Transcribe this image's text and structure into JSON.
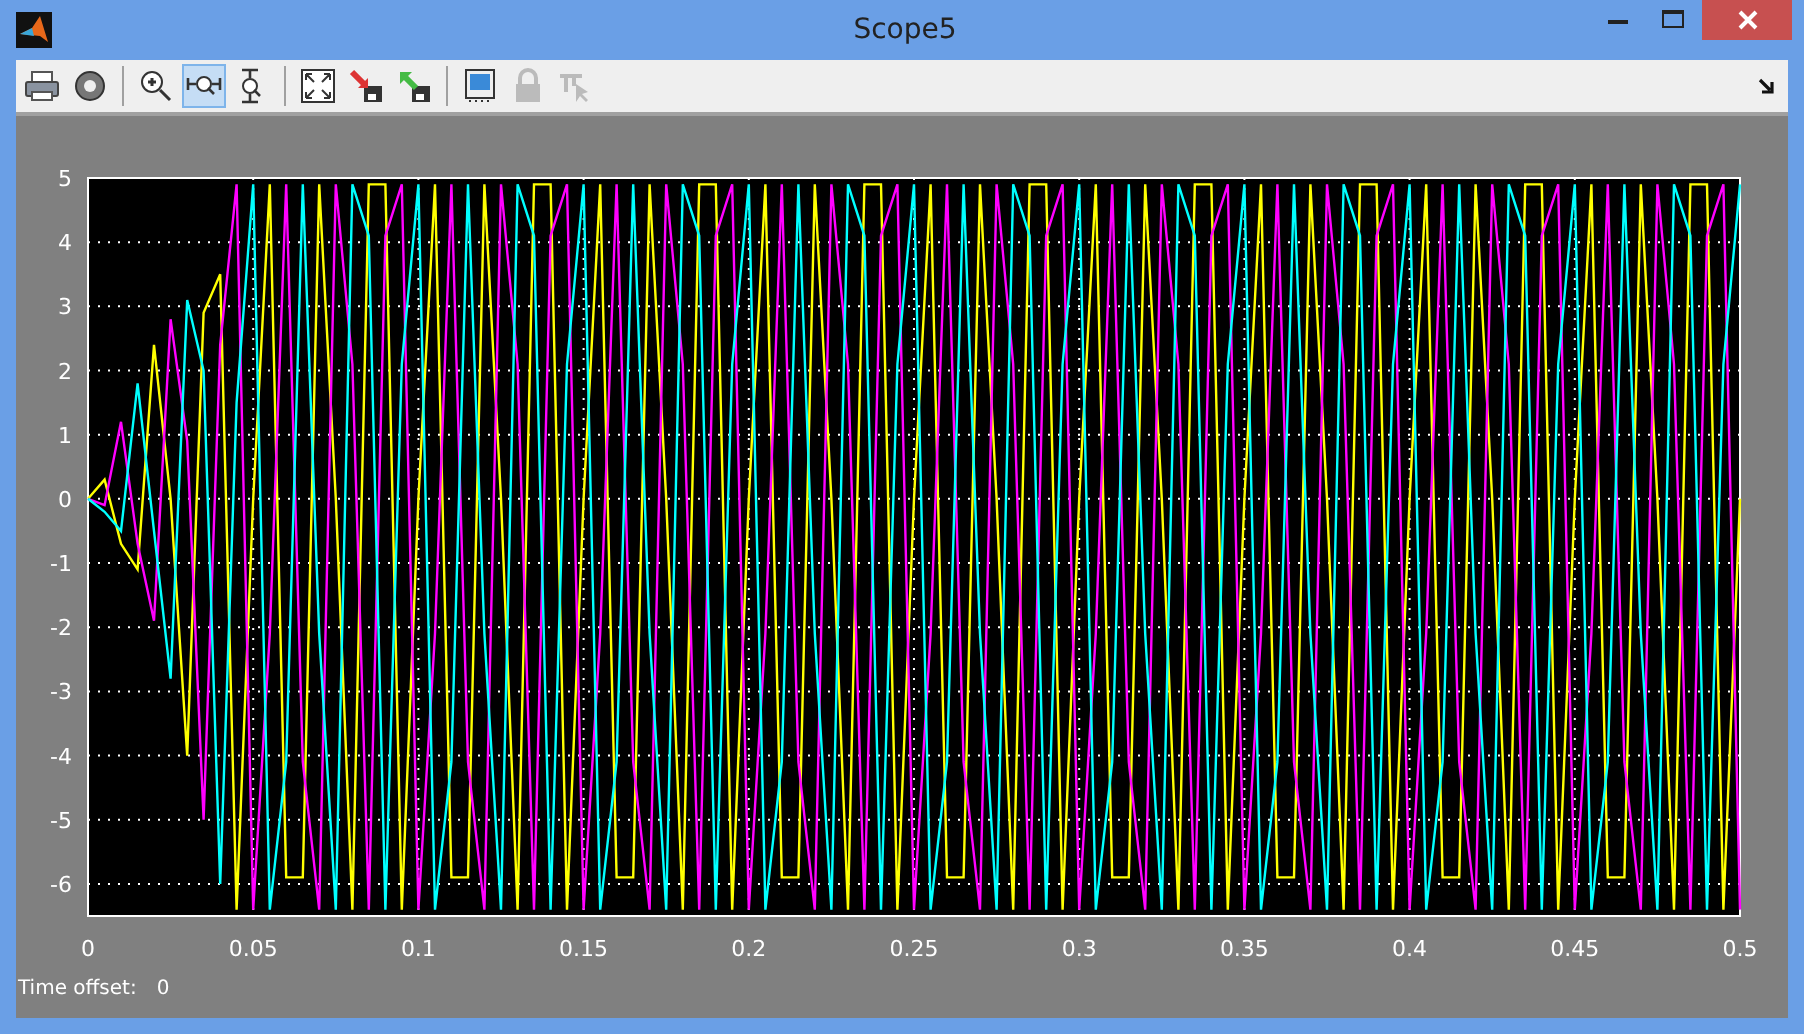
{
  "window": {
    "title": "Scope5"
  },
  "toolbar": [
    {
      "kind": "print",
      "selected": false,
      "disabled": false
    },
    {
      "kind": "parameters",
      "selected": false,
      "disabled": false
    },
    {
      "kind": "zoom",
      "selected": false,
      "disabled": false
    },
    {
      "kind": "zoomx",
      "selected": true,
      "disabled": false
    },
    {
      "kind": "zoomy",
      "selected": false,
      "disabled": false
    },
    {
      "kind": "autoscale",
      "selected": false,
      "disabled": false
    },
    {
      "kind": "saveaxes",
      "selected": false,
      "disabled": false
    },
    {
      "kind": "restoreaxes",
      "selected": false,
      "disabled": false
    },
    {
      "kind": "floating",
      "selected": false,
      "disabled": false
    },
    {
      "kind": "lock",
      "selected": false,
      "disabled": true
    },
    {
      "kind": "signals",
      "selected": false,
      "disabled": true
    }
  ],
  "chart_data": {
    "type": "line",
    "grid": true,
    "xlim": [
      0,
      0.5
    ],
    "ylim": [
      -6.5,
      5
    ],
    "xticks": [
      0,
      {
        "value": 0.05,
        "label": "0.05"
      },
      {
        "value": 0.1,
        "label": "0.1"
      },
      {
        "value": 0.15,
        "label": "0.15"
      },
      {
        "value": 0.2,
        "label": "0.2"
      },
      {
        "value": 0.25,
        "label": "0.25"
      },
      {
        "value": 0.3,
        "label": "0.3"
      },
      {
        "value": 0.35,
        "label": "0.35"
      },
      {
        "value": 0.4,
        "label": "0.4"
      },
      {
        "value": 0.45,
        "label": "0.45"
      },
      {
        "value": 0.5,
        "label": "0.5"
      }
    ],
    "yticks": [
      -6,
      -5,
      -4,
      -3,
      -2,
      -1,
      0,
      1,
      2,
      3,
      4,
      5
    ],
    "x": [
      0,
      0.005,
      0.01,
      0.015,
      0.02,
      0.025,
      0.03,
      0.035,
      0.04,
      0.045,
      0.05,
      0.055,
      0.06,
      0.065,
      0.07,
      0.075,
      0.08,
      0.085,
      0.09,
      0.095,
      0.1,
      0.105,
      0.11,
      0.115,
      0.12,
      0.125,
      0.13,
      0.135,
      0.14,
      0.145,
      0.15,
      0.155,
      0.16,
      0.165,
      0.17,
      0.175,
      0.18,
      0.185,
      0.19,
      0.195,
      0.2,
      0.205,
      0.21,
      0.215,
      0.22,
      0.225,
      0.23,
      0.235,
      0.24,
      0.245,
      0.25,
      0.255,
      0.26,
      0.265,
      0.27,
      0.275,
      0.28,
      0.285,
      0.29,
      0.295,
      0.3,
      0.305,
      0.31,
      0.315,
      0.32,
      0.325,
      0.33,
      0.335,
      0.34,
      0.345,
      0.35,
      0.355,
      0.36,
      0.365,
      0.37,
      0.375,
      0.38,
      0.385,
      0.39,
      0.395,
      0.4,
      0.405,
      0.41,
      0.415,
      0.42,
      0.425,
      0.43,
      0.435,
      0.44,
      0.445,
      0.45,
      0.455,
      0.46,
      0.465,
      0.47,
      0.475,
      0.48,
      0.485,
      0.49,
      0.495,
      0.5
    ],
    "series": [
      {
        "color": "#ffff00",
        "values": [
          0,
          0.3,
          -0.7,
          -1.1,
          2.4,
          0,
          -4,
          2.9,
          3.5,
          -6.4,
          0,
          4.9,
          -5.9,
          -5.9,
          4.9,
          0,
          -6.4,
          4.9,
          4.9,
          -6.4,
          0,
          4.9,
          -5.9,
          -5.9,
          4.9,
          0,
          -6.4,
          4.9,
          4.9,
          -6.4,
          0,
          4.9,
          -5.9,
          -5.9,
          4.9,
          0,
          -6.4,
          4.9,
          4.9,
          -6.4,
          0,
          4.9,
          -5.9,
          -5.9,
          4.9,
          0,
          -6.4,
          4.9,
          4.9,
          -6.4,
          0,
          4.9,
          -5.9,
          -5.9,
          4.9,
          0,
          -6.4,
          4.9,
          4.9,
          -6.4,
          0,
          4.9,
          -5.9,
          -5.9,
          4.9,
          0,
          -6.4,
          4.9,
          4.9,
          -6.4,
          0,
          4.9,
          -5.9,
          -5.9,
          4.9,
          0,
          -6.4,
          4.9,
          4.9,
          -6.4,
          0,
          4.9,
          -5.9,
          -5.9,
          4.9,
          0,
          -6.4,
          4.9,
          4.9,
          -6.4,
          0,
          4.9,
          -5.9,
          -5.9,
          4.9,
          0,
          -6.4,
          4.9,
          4.9,
          -6.4,
          0
        ]
      },
      {
        "color": "#ff00ff",
        "values": [
          0,
          -0.1,
          1.2,
          -0.7,
          -1.9,
          2.8,
          0.9,
          -5,
          2.4,
          4.9,
          -6.4,
          -2.1,
          4.9,
          -4.1,
          -6.4,
          4.9,
          2.1,
          -6.4,
          4.1,
          4.9,
          -6.4,
          -2.1,
          4.9,
          -4.1,
          -6.4,
          4.9,
          2.1,
          -6.4,
          4.1,
          4.9,
          -6.4,
          -2.1,
          4.9,
          -4.1,
          -6.4,
          4.9,
          2.1,
          -6.4,
          4.1,
          4.9,
          -6.4,
          -2.1,
          4.9,
          -4.1,
          -6.4,
          4.9,
          2.1,
          -6.4,
          4.1,
          4.9,
          -6.4,
          -2.1,
          4.9,
          -4.1,
          -6.4,
          4.9,
          2.1,
          -6.4,
          4.1,
          4.9,
          -6.4,
          -2.1,
          4.9,
          -4.1,
          -6.4,
          4.9,
          2.1,
          -6.4,
          4.1,
          4.9,
          -6.4,
          -2.1,
          4.9,
          -4.1,
          -6.4,
          4.9,
          2.1,
          -6.4,
          4.1,
          4.9,
          -6.4,
          -2.1,
          4.9,
          -4.1,
          -6.4,
          4.9,
          2.1,
          -6.4,
          4.1,
          4.9,
          -6.4,
          -2.1,
          4.9,
          -4.1,
          -6.4,
          4.9,
          2.1,
          -6.4,
          4.1,
          4.9,
          -6.4
        ]
      },
      {
        "color": "#00ffff",
        "values": [
          0,
          -0.2,
          -0.5,
          1.8,
          -0.5,
          -2.8,
          3.1,
          2,
          -6,
          1.5,
          4.9,
          -6.4,
          -4.1,
          4.9,
          -2.1,
          -6.4,
          4.9,
          4.1,
          -6.4,
          2.1,
          4.9,
          -6.4,
          -4.1,
          4.9,
          -2.1,
          -6.4,
          4.9,
          4.1,
          -6.4,
          2.1,
          4.9,
          -6.4,
          -4.1,
          4.9,
          -2.1,
          -6.4,
          4.9,
          4.1,
          -6.4,
          2.1,
          4.9,
          -6.4,
          -4.1,
          4.9,
          -2.1,
          -6.4,
          4.9,
          4.1,
          -6.4,
          2.1,
          4.9,
          -6.4,
          -4.1,
          4.9,
          -2.1,
          -6.4,
          4.9,
          4.1,
          -6.4,
          2.1,
          4.9,
          -6.4,
          -4.1,
          4.9,
          -2.1,
          -6.4,
          4.9,
          4.1,
          -6.4,
          2.1,
          4.9,
          -6.4,
          -4.1,
          4.9,
          -2.1,
          -6.4,
          4.9,
          4.1,
          -6.4,
          2.1,
          4.9,
          -6.4,
          -4.1,
          4.9,
          -2.1,
          -6.4,
          4.9,
          4.1,
          -6.4,
          2.1,
          4.9,
          -6.4,
          -4.1,
          4.9,
          -2.1,
          -6.4,
          4.9,
          4.1,
          -6.4,
          2.1,
          4.9
        ]
      }
    ]
  },
  "time_offset": {
    "label": "Time offset:",
    "value": "0"
  }
}
